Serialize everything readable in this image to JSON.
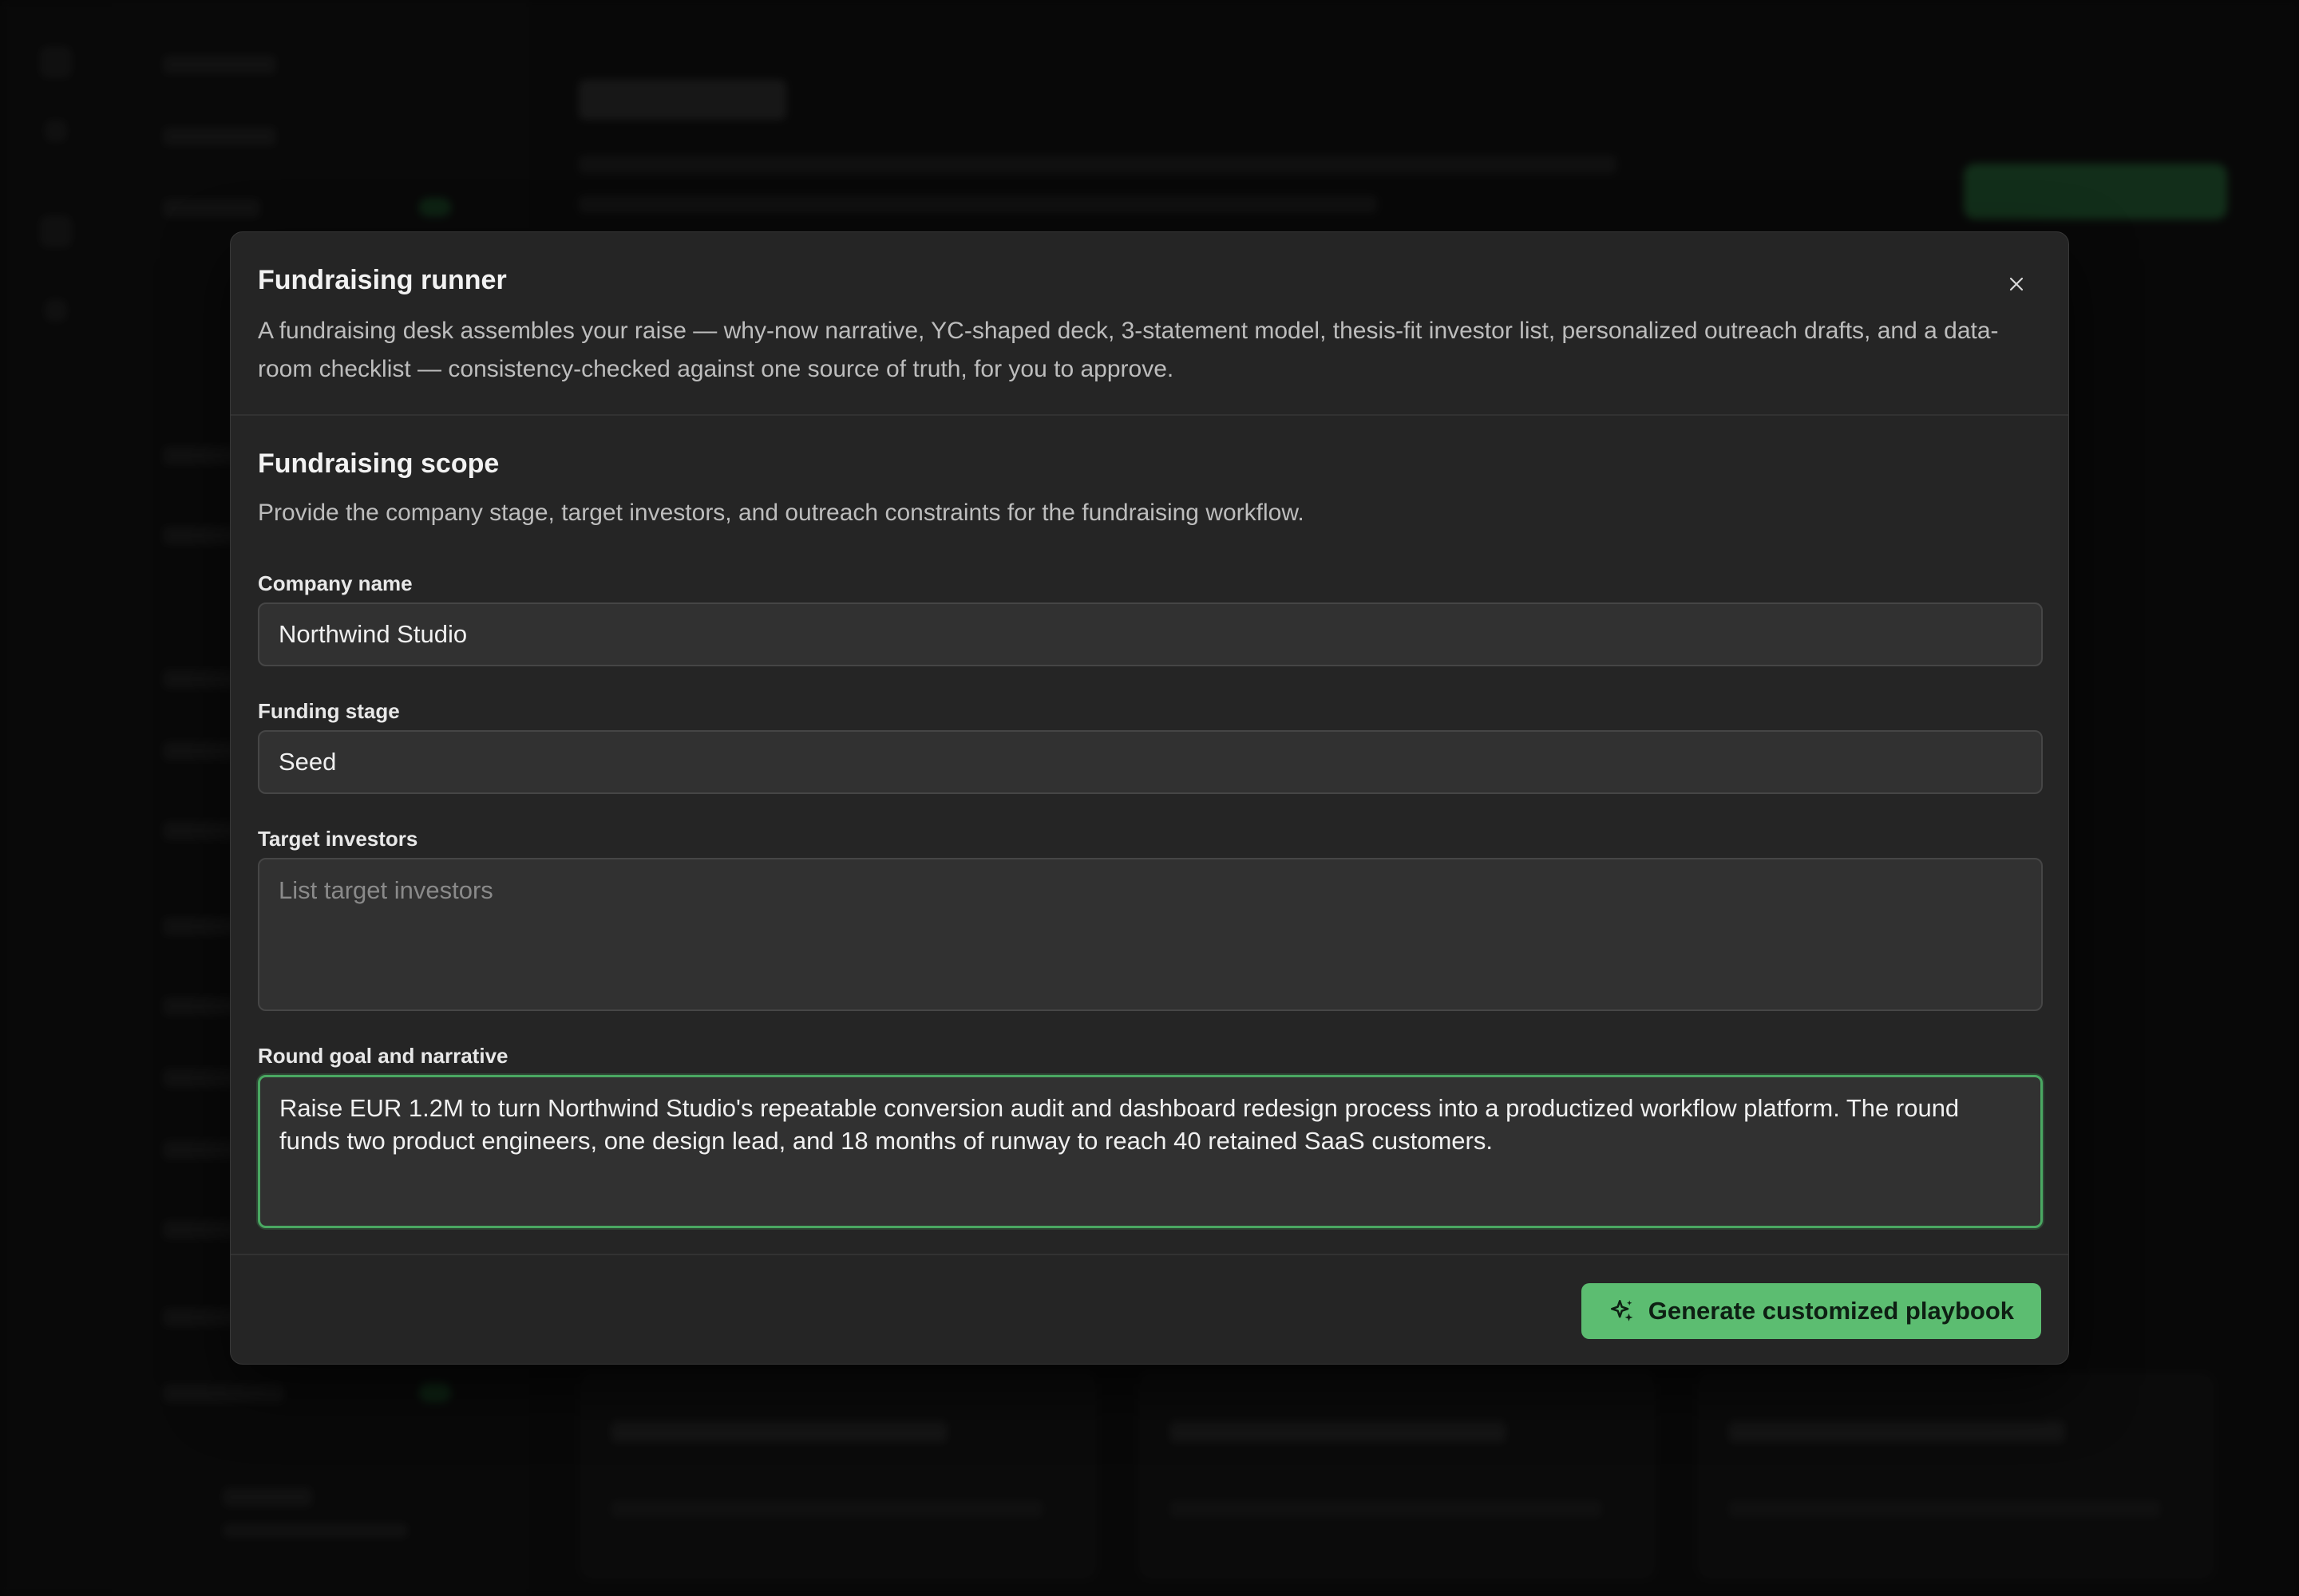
{
  "modal": {
    "title": "Fundraising runner",
    "description": "A fundraising desk assembles your raise — why-now narrative, YC-shaped deck, 3-statement model, thesis-fit investor list, personalized outreach drafts, and a data-room checklist — consistency-checked against one source of truth, for you to approve.",
    "close_icon": "close-icon"
  },
  "section": {
    "title": "Fundraising scope",
    "description": "Provide the company stage, target investors, and outreach constraints for the fundraising workflow."
  },
  "fields": {
    "company_name": {
      "label": "Company name",
      "value": "Northwind Studio"
    },
    "funding_stage": {
      "label": "Funding stage",
      "value": "Seed"
    },
    "target_investors": {
      "label": "Target investors",
      "value": "",
      "placeholder": "List target investors"
    },
    "round_goal": {
      "label": "Round goal and narrative",
      "value": "Raise EUR 1.2M to turn Northwind Studio's repeatable conversion audit and dashboard redesign process into a productized workflow platform. The round funds two product engineers, one design lead, and 18 months of runway to reach 40 retained SaaS customers."
    }
  },
  "footer": {
    "primary_label": "Generate customized playbook",
    "primary_icon": "sparkles-icon"
  },
  "colors": {
    "accent": "#5cbd71",
    "focus_border": "#4aa862",
    "modal_bg": "#252525"
  }
}
